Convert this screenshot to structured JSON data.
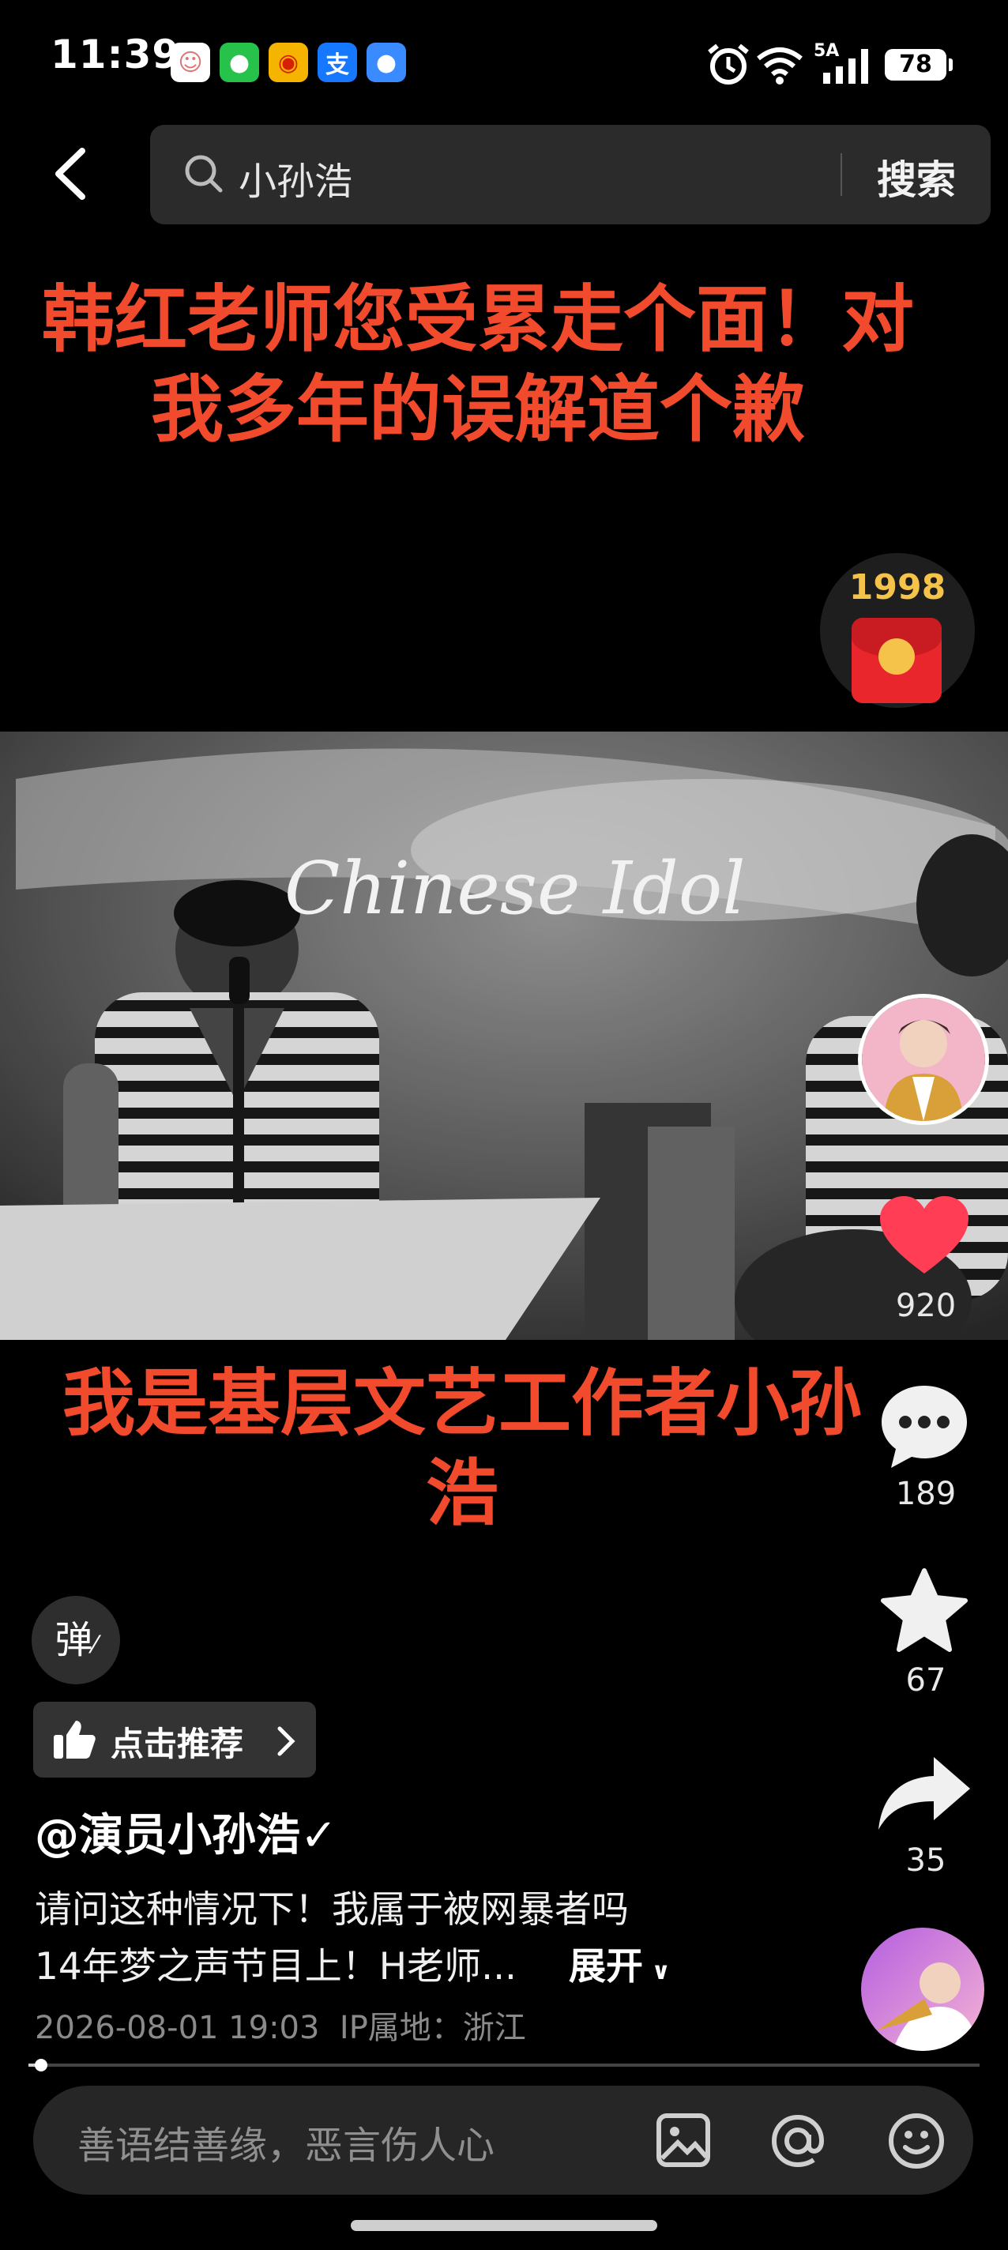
{
  "status_bar": {
    "time": "11:39",
    "network": "5A",
    "battery": "78",
    "apps": [
      {
        "name": "avatar-app",
        "glyph": "☺",
        "bg": "#ffffff",
        "fg": "#d77"
      },
      {
        "name": "wechat",
        "glyph": "●",
        "bg": "#27c24c",
        "fg": "#ffffff"
      },
      {
        "name": "weibo",
        "glyph": "◉",
        "bg": "#f5b400",
        "fg": "#d81e06"
      },
      {
        "name": "alipay",
        "glyph": "支",
        "bg": "#1677ff",
        "fg": "#ffffff"
      },
      {
        "name": "messages",
        "glyph": "●",
        "bg": "#3a8bff",
        "fg": "#ffffff"
      }
    ]
  },
  "search": {
    "query": "小孙浩",
    "button": "搜索"
  },
  "video": {
    "title_top": "韩红老师您受累走个面！对我多年的误解道个歉",
    "title_bottom": "我是基层文艺工作者小孙浩",
    "logo_text": "Chinese Idol",
    "gift_year": "1998"
  },
  "rail": {
    "likes": "920",
    "comments": "189",
    "stars": "67",
    "shares": "35"
  },
  "danmu_label": "弹",
  "recommend_label": "点击推荐",
  "post": {
    "author": "@演员小孙浩",
    "desc_line1": "请问这种情况下！我属于被网暴者吗",
    "desc_line2": "14年梦之声节目上！H老师...",
    "expand": "展开",
    "datetime": "2026-08-01 19:03",
    "ip": "IP属地：浙江"
  },
  "progress": 0.01,
  "comment_placeholder": "善语结善缘，恶言伤人心",
  "colors": {
    "accent_red": "#f24a2c",
    "background": "#000000"
  }
}
